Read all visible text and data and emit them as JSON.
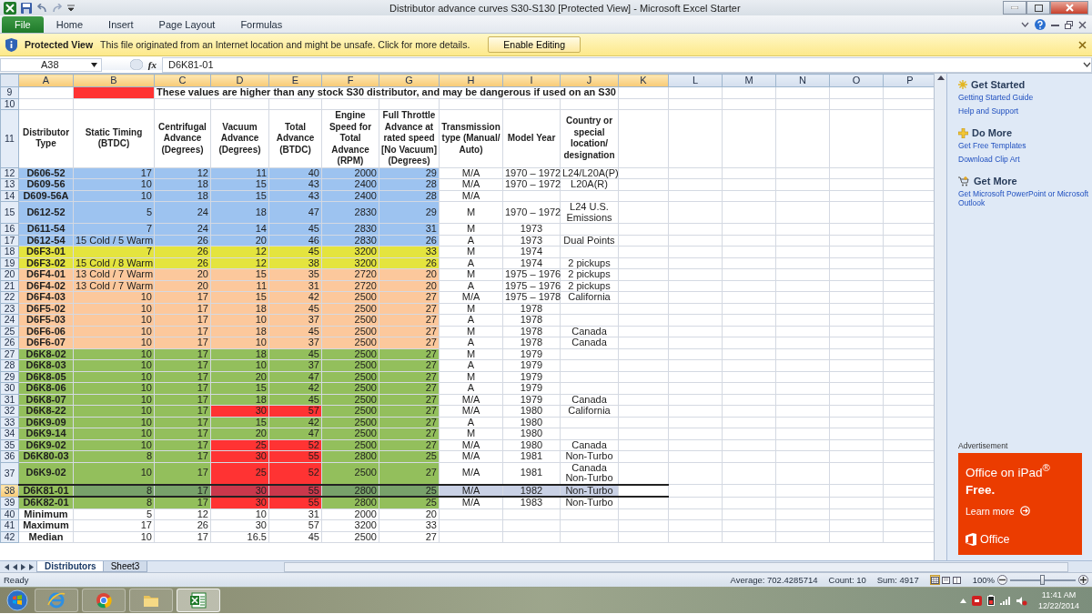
{
  "window": {
    "title": "Distributor advance curves S30-S130 [Protected View] - Microsoft Excel Starter"
  },
  "ribbon_tabs": [
    {
      "label": "File",
      "kind": "file"
    },
    {
      "label": "Home",
      "kind": "tab"
    },
    {
      "label": "Insert",
      "kind": "tab"
    },
    {
      "label": "Page Layout",
      "kind": "tab"
    },
    {
      "label": "Formulas",
      "kind": "tab"
    }
  ],
  "protected_view": {
    "title": "Protected View",
    "message": "This file originated from an Internet location and might be unsafe. Click for more details.",
    "button": "Enable Editing"
  },
  "formula_bar": {
    "name_box": "A38",
    "fx": "fx",
    "value": "D6K81-01"
  },
  "columns": [
    {
      "label": "A",
      "selected": true
    },
    {
      "label": "B",
      "selected": true
    },
    {
      "label": "C",
      "selected": true
    },
    {
      "label": "D",
      "selected": true
    },
    {
      "label": "E",
      "selected": true
    },
    {
      "label": "F",
      "selected": true
    },
    {
      "label": "G",
      "selected": true
    },
    {
      "label": "H",
      "selected": true
    },
    {
      "label": "I",
      "selected": true
    },
    {
      "label": "J",
      "selected": true
    },
    {
      "label": "K",
      "selected": true
    },
    {
      "label": "L",
      "selected": false
    },
    {
      "label": "M",
      "selected": false
    },
    {
      "label": "N",
      "selected": false
    },
    {
      "label": "O",
      "selected": false
    },
    {
      "label": "P",
      "selected": false
    }
  ],
  "rows": [
    {
      "number": "9",
      "kind": "legend",
      "note": "These values are higher than any stock S30 distributor, and may be dangerous if used on an S30"
    },
    {
      "number": "10",
      "kind": "blank"
    },
    {
      "number": "11",
      "kind": "header",
      "cells": {
        "A": "Distributor Type",
        "B": "Static Timing (BTDC)",
        "C": "Centrifugal Advance (Degrees)",
        "D": "Vacuum Advance (Degrees)",
        "E": "Total Advance (BTDC)",
        "F": "Engine Speed for Total Advance (RPM)",
        "G": "Full Throttle Advance at rated speed [No Vacuum](Degrees)",
        "H": "Transmission type (Manual/ Auto)",
        "I": "Model Year",
        "J": "Country or special location/ designation"
      }
    },
    {
      "number": "12",
      "kind": "data",
      "color": "#9dc3f0",
      "flagged": false,
      "selected": false,
      "cells": {
        "A": "D606-52",
        "B": "17",
        "C": "12",
        "D": "11",
        "E": "40",
        "F": "2000",
        "G": "29",
        "H": "M/A",
        "I": "1970 – 1972",
        "J": "L24/L20A(P)"
      }
    },
    {
      "number": "13",
      "kind": "data",
      "color": "#9dc3f0",
      "flagged": false,
      "selected": false,
      "cells": {
        "A": "D609-56",
        "B": "10",
        "C": "18",
        "D": "15",
        "E": "43",
        "F": "2400",
        "G": "28",
        "H": "M/A",
        "I": "1970 – 1972",
        "J": "L20A(R)"
      }
    },
    {
      "number": "14",
      "kind": "data",
      "color": "#9dc3f0",
      "flagged": false,
      "selected": false,
      "cells": {
        "A": "D609-56A",
        "B": "10",
        "C": "18",
        "D": "15",
        "E": "43",
        "F": "2400",
        "G": "28",
        "H": "M/A"
      }
    },
    {
      "number": "15",
      "kind": "data",
      "color": "#9dc3f0",
      "flagged": false,
      "selected": false,
      "cells": {
        "A": "D612-52",
        "B": "5",
        "C": "24",
        "D": "18",
        "E": "47",
        "F": "2830",
        "G": "29",
        "H": "M",
        "I": "1970 – 1972",
        "J": "L24 U.S. Emissions"
      }
    },
    {
      "number": "16",
      "kind": "data",
      "color": "#9dc3f0",
      "flagged": false,
      "selected": false,
      "cells": {
        "A": "D611-54",
        "B": "7",
        "C": "24",
        "D": "14",
        "E": "45",
        "F": "2830",
        "G": "31",
        "H": "M",
        "I": "1973"
      }
    },
    {
      "number": "17",
      "kind": "data",
      "color": "#9dc3f0",
      "flagged": false,
      "selected": false,
      "static_timing_text": true,
      "cells": {
        "A": "D612-54",
        "B": "15 Cold / 5 Warm",
        "C": "26",
        "D": "20",
        "E": "46",
        "F": "2830",
        "G": "26",
        "H": "A",
        "I": "1973",
        "J": "Dual Points"
      }
    },
    {
      "number": "18",
      "kind": "data",
      "color": "#e4e43e",
      "flagged": false,
      "selected": false,
      "cells": {
        "A": "D6F3-01",
        "B": "7",
        "C": "26",
        "D": "12",
        "E": "45",
        "F": "3200",
        "G": "33",
        "H": "M",
        "I": "1974"
      }
    },
    {
      "number": "19",
      "kind": "data",
      "color": "#e4e43e",
      "flagged": false,
      "selected": false,
      "static_timing_text": true,
      "cells": {
        "A": "D6F3-02",
        "B": "15 Cold / 8 Warm",
        "C": "26",
        "D": "12",
        "E": "38",
        "F": "3200",
        "G": "26",
        "H": "A",
        "I": "1974",
        "J": "2 pickups"
      }
    },
    {
      "number": "20",
      "kind": "data",
      "color": "#fcc89c",
      "flagged": false,
      "selected": false,
      "static_timing_text": true,
      "cells": {
        "A": "D6F4-01",
        "B": "13 Cold / 7 Warm",
        "C": "20",
        "D": "15",
        "E": "35",
        "F": "2720",
        "G": "20",
        "H": "M",
        "I": "1975 – 1976",
        "J": "2 pickups"
      }
    },
    {
      "number": "21",
      "kind": "data",
      "color": "#fcc89c",
      "flagged": false,
      "selected": false,
      "static_timing_text": true,
      "cells": {
        "A": "D6F4-02",
        "B": "13 Cold / 7 Warm",
        "C": "20",
        "D": "11",
        "E": "31",
        "F": "2720",
        "G": "20",
        "H": "A",
        "I": "1975 – 1976",
        "J": "2 pickups"
      }
    },
    {
      "number": "22",
      "kind": "data",
      "color": "#fcc89c",
      "flagged": false,
      "selected": false,
      "cells": {
        "A": "D6F4-03",
        "B": "10",
        "C": "17",
        "D": "15",
        "E": "42",
        "F": "2500",
        "G": "27",
        "H": "M/A",
        "I": "1975 – 1978",
        "J": "California"
      }
    },
    {
      "number": "23",
      "kind": "data",
      "color": "#fcc89c",
      "flagged": false,
      "selected": false,
      "cells": {
        "A": "D6F5-02",
        "B": "10",
        "C": "17",
        "D": "18",
        "E": "45",
        "F": "2500",
        "G": "27",
        "H": "M",
        "I": "1978"
      }
    },
    {
      "number": "24",
      "kind": "data",
      "color": "#fcc89c",
      "flagged": false,
      "selected": false,
      "cells": {
        "A": "D6F5-03",
        "B": "10",
        "C": "17",
        "D": "10",
        "E": "37",
        "F": "2500",
        "G": "27",
        "H": "A",
        "I": "1978"
      }
    },
    {
      "number": "25",
      "kind": "data",
      "color": "#fcc89c",
      "flagged": false,
      "selected": false,
      "cells": {
        "A": "D6F6-06",
        "B": "10",
        "C": "17",
        "D": "18",
        "E": "45",
        "F": "2500",
        "G": "27",
        "H": "M",
        "I": "1978",
        "J": "Canada"
      }
    },
    {
      "number": "26",
      "kind": "data",
      "color": "#fcc89c",
      "flagged": false,
      "selected": false,
      "cells": {
        "A": "D6F6-07",
        "B": "10",
        "C": "17",
        "D": "10",
        "E": "37",
        "F": "2500",
        "G": "27",
        "H": "A",
        "I": "1978",
        "J": "Canada"
      }
    },
    {
      "number": "27",
      "kind": "data",
      "color": "#93bf5c",
      "flagged": false,
      "selected": false,
      "cells": {
        "A": "D6K8-02",
        "B": "10",
        "C": "17",
        "D": "18",
        "E": "45",
        "F": "2500",
        "G": "27",
        "H": "M",
        "I": "1979"
      }
    },
    {
      "number": "28",
      "kind": "data",
      "color": "#93bf5c",
      "flagged": false,
      "selected": false,
      "cells": {
        "A": "D6K8-03",
        "B": "10",
        "C": "17",
        "D": "10",
        "E": "37",
        "F": "2500",
        "G": "27",
        "H": "A",
        "I": "1979"
      }
    },
    {
      "number": "29",
      "kind": "data",
      "color": "#93bf5c",
      "flagged": false,
      "selected": false,
      "cells": {
        "A": "D6K8-05",
        "B": "10",
        "C": "17",
        "D": "20",
        "E": "47",
        "F": "2500",
        "G": "27",
        "H": "M",
        "I": "1979"
      }
    },
    {
      "number": "30",
      "kind": "data",
      "color": "#93bf5c",
      "flagged": false,
      "selected": false,
      "cells": {
        "A": "D6K8-06",
        "B": "10",
        "C": "17",
        "D": "15",
        "E": "42",
        "F": "2500",
        "G": "27",
        "H": "A",
        "I": "1979"
      }
    },
    {
      "number": "31",
      "kind": "data",
      "color": "#93bf5c",
      "flagged": false,
      "selected": false,
      "cells": {
        "A": "D6K8-07",
        "B": "10",
        "C": "17",
        "D": "18",
        "E": "45",
        "F": "2500",
        "G": "27",
        "H": "M/A",
        "I": "1979",
        "J": "Canada"
      }
    },
    {
      "number": "32",
      "kind": "data",
      "color": "#93bf5c",
      "flagged": true,
      "selected": false,
      "cells": {
        "A": "D6K8-22",
        "B": "10",
        "C": "17",
        "D": "30",
        "E": "57",
        "F": "2500",
        "G": "27",
        "H": "M/A",
        "I": "1980",
        "J": "California"
      }
    },
    {
      "number": "33",
      "kind": "data",
      "color": "#93bf5c",
      "flagged": false,
      "selected": false,
      "cells": {
        "A": "D6K9-09",
        "B": "10",
        "C": "17",
        "D": "15",
        "E": "42",
        "F": "2500",
        "G": "27",
        "H": "A",
        "I": "1980"
      }
    },
    {
      "number": "34",
      "kind": "data",
      "color": "#93bf5c",
      "flagged": false,
      "selected": false,
      "cells": {
        "A": "D6K9-14",
        "B": "10",
        "C": "17",
        "D": "20",
        "E": "47",
        "F": "2500",
        "G": "27",
        "H": "M",
        "I": "1980"
      }
    },
    {
      "number": "35",
      "kind": "data",
      "color": "#93bf5c",
      "flagged": true,
      "selected": false,
      "cells": {
        "A": "D6K9-02",
        "B": "10",
        "C": "17",
        "D": "25",
        "E": "52",
        "F": "2500",
        "G": "27",
        "H": "M/A",
        "I": "1980",
        "J": "Canada"
      }
    },
    {
      "number": "36",
      "kind": "data",
      "color": "#93bf5c",
      "flagged": true,
      "selected": false,
      "cells": {
        "A": "D6K80-03",
        "B": "8",
        "C": "17",
        "D": "30",
        "E": "55",
        "F": "2800",
        "G": "25",
        "H": "M/A",
        "I": "1981",
        "J": "Non-Turbo"
      }
    },
    {
      "number": "37",
      "kind": "data",
      "color": "#93bf5c",
      "flagged": true,
      "selected": false,
      "cells": {
        "A": "D6K9-02",
        "B": "10",
        "C": "17",
        "D": "25",
        "E": "52",
        "F": "2500",
        "G": "27",
        "H": "M/A",
        "I": "1981",
        "J": "Canada Non-Turbo"
      }
    },
    {
      "number": "38",
      "kind": "data",
      "color": "#93bf5c",
      "flagged": true,
      "selected": true,
      "cells": {
        "A": "D6K81-01",
        "B": "8",
        "C": "17",
        "D": "30",
        "E": "55",
        "F": "2800",
        "G": "25",
        "H": "M/A",
        "I": "1982",
        "J": "Non-Turbo"
      }
    },
    {
      "number": "39",
      "kind": "data",
      "color": "#93bf5c",
      "flagged": true,
      "selected": false,
      "cells": {
        "A": "D6K82-01",
        "B": "8",
        "C": "17",
        "D": "30",
        "E": "55",
        "F": "2800",
        "G": "25",
        "H": "M/A",
        "I": "1983",
        "J": "Non-Turbo"
      }
    },
    {
      "number": "40",
      "kind": "summary",
      "cells": {
        "A": "Minimum",
        "B": "5",
        "C": "12",
        "D": "10",
        "E": "31",
        "F": "2000",
        "G": "20"
      }
    },
    {
      "number": "41",
      "kind": "summary",
      "cells": {
        "A": "Maximum",
        "B": "17",
        "C": "26",
        "D": "30",
        "E": "57",
        "F": "3200",
        "G": "33"
      }
    },
    {
      "number": "42",
      "kind": "summary",
      "cells": {
        "A": "Median",
        "B": "10",
        "C": "17",
        "D": "16.5",
        "E": "45",
        "F": "2500",
        "G": "27"
      }
    }
  ],
  "sheet_tabs": [
    {
      "label": "Distributors",
      "selected": true
    },
    {
      "label": "Sheet3",
      "selected": false
    }
  ],
  "status_bar": {
    "mode": "Ready",
    "stats": [
      "Average: 702.4285714",
      "Count: 10",
      "Sum: 4917"
    ],
    "views": [
      {
        "selected": true
      },
      {
        "selected": false
      },
      {
        "selected": false
      }
    ],
    "zoom": "100%",
    "zoom_slider": {
      "level": 0.5
    }
  },
  "task_pane": {
    "sections": [
      {
        "title": "Get Started",
        "links": [
          "Getting Started Guide",
          "Help and Support"
        ]
      },
      {
        "title": "Do More",
        "links": [
          "Get Free Templates",
          "Download Clip Art"
        ]
      },
      {
        "title": "Get More",
        "links": [
          "Get Microsoft PowerPoint or Microsoft Outlook"
        ]
      }
    ],
    "ad": {
      "label": "Advertisement",
      "headline": "Office on iPad$^{®}$",
      "subhead": "Free.",
      "link": "Learn more",
      "brand": "Office"
    }
  },
  "taskbar": {
    "apps": [
      {
        "active": false
      },
      {
        "active": false
      },
      {
        "active": false
      },
      {
        "active": true
      }
    ],
    "time": "11:41 AM",
    "date": "12/22/2014"
  }
}
